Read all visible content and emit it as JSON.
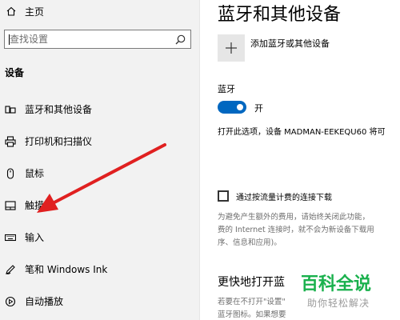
{
  "sidebar": {
    "home_label": "主页",
    "search_placeholder": "查找设置",
    "section_heading": "设备",
    "items": [
      {
        "label": "蓝牙和其他设备",
        "icon": "devices-icon"
      },
      {
        "label": "打印机和扫描仪",
        "icon": "printer-icon"
      },
      {
        "label": "鼠标",
        "icon": "mouse-icon"
      },
      {
        "label": "触摸板",
        "icon": "touchpad-icon"
      },
      {
        "label": "输入",
        "icon": "keyboard-icon"
      },
      {
        "label": "笔和 Windows Ink",
        "icon": "pen-icon"
      },
      {
        "label": "自动播放",
        "icon": "autoplay-icon"
      }
    ]
  },
  "main": {
    "title": "蓝牙和其他设备",
    "add_device_label": "添加蓝牙或其他设备",
    "bluetooth_heading": "蓝牙",
    "toggle_state": "开",
    "toggle_on": true,
    "discover_text": "打开此选项，设备 MADMAN-EEKEQU60 将可",
    "metered_label": "通过按流量计费的连接下载",
    "metered_checked": false,
    "metered_desc": [
      "为避免产生额外的费用，请始终关闭此功能，",
      "费的 Internet 连接时，就不会为新设备下载用",
      "序、信息和应用)。"
    ],
    "section2_title": "更快地打开蓝",
    "section2_desc": [
      "若要在不打开\"设置\"",
      "蓝牙图标。如果想要"
    ]
  },
  "watermark": {
    "title": "百科全说",
    "subtitle": "助你轻松解决"
  },
  "colors": {
    "accent": "#0067c0",
    "sidebar_bg": "#f2f2f2",
    "arrow": "#e02020",
    "watermark": "#1ab14d"
  }
}
